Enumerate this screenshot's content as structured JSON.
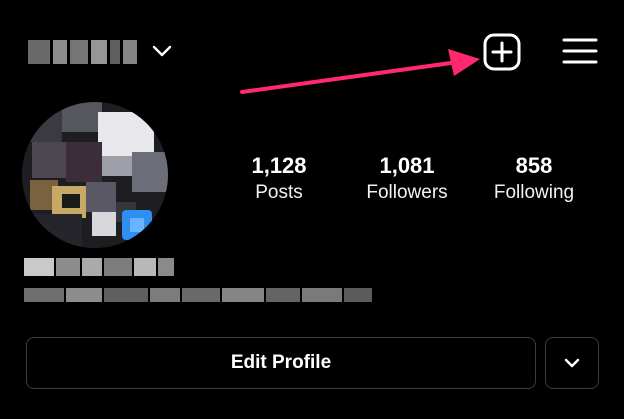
{
  "header": {
    "username_icon": "blurred-username",
    "new_post_icon": "plus-square-icon",
    "menu_icon": "hamburger-menu-icon",
    "annotation_color": "#ff2a6d"
  },
  "stats": [
    {
      "value": "1,128",
      "label": "Posts"
    },
    {
      "value": "1,081",
      "label": "Followers"
    },
    {
      "value": "858",
      "label": "Following"
    }
  ],
  "actions": {
    "edit_profile_label": "Edit Profile",
    "more_icon": "chevron-down-icon"
  }
}
